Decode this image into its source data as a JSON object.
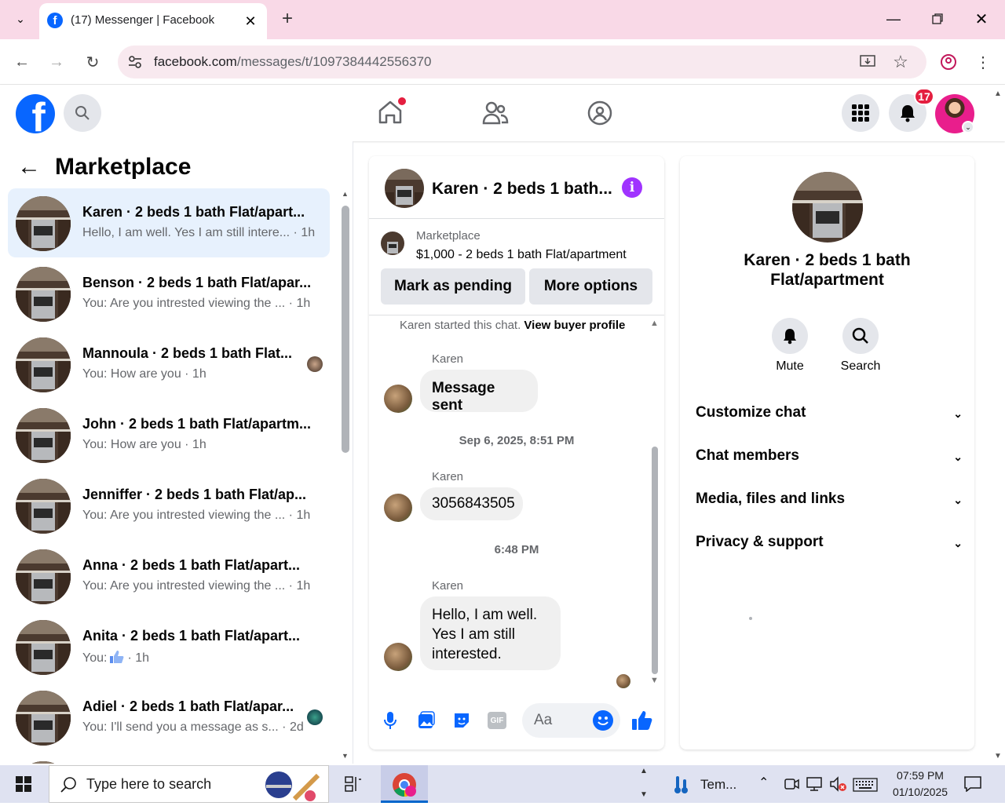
{
  "browser": {
    "tab_title": "(17) Messenger | Facebook",
    "url_domain": "facebook.com",
    "url_path": "/messages/t/1097384442556370"
  },
  "fb_header": {
    "notification_count": "17",
    "icons": [
      "facebook-logo",
      "search-icon",
      "home-icon",
      "friends-icon",
      "groups-icon",
      "menu-grid-icon",
      "bell-icon",
      "avatar"
    ]
  },
  "left": {
    "title": "Marketplace",
    "conversations": [
      {
        "name": "Karen · 2 beds 1 bath Flat/apart...",
        "preview": "Hello, I am well. Yes I am still intere... · 1h"
      },
      {
        "name": "Benson · 2 beds 1 bath Flat/apar...",
        "preview": "You: Are you intrested viewing the ... · 1h"
      },
      {
        "name": "Mannoula · 2 beds 1 bath Flat...",
        "preview": "You: How are you · 1h"
      },
      {
        "name": "John · 2 beds 1 bath Flat/apartm...",
        "preview": "You: How are you · 1h"
      },
      {
        "name": "Jenniffer · 2 beds 1 bath Flat/ap...",
        "preview": "You: Are you intrested viewing the ... · 1h"
      },
      {
        "name": "Anna · 2 beds 1 bath Flat/apart...",
        "preview": "You: Are you intrested viewing the ... · 1h"
      },
      {
        "name": "Anita · 2 beds 1 bath Flat/apart...",
        "preview_prefix": "You:",
        "preview": "· 1h"
      },
      {
        "name": "Adiel · 2 beds 1 bath Flat/apar...",
        "preview": "You: I'll send you a message as s... · 2d"
      }
    ]
  },
  "chat": {
    "title": "Karen · 2 beds 1 bath...",
    "listing_label": "Marketplace",
    "listing_detail": "$1,000 - 2 beds 1 bath Flat/apartment",
    "mark_pending": "Mark as pending",
    "more_options": "More options",
    "started_text": "Karen started this chat.",
    "view_profile": "View buyer profile",
    "sender_name": "Karen",
    "msg1": "Message sent",
    "ts1": "Sep 6, 2025, 8:51 PM",
    "msg2": "3056843505",
    "ts2": "6:48 PM",
    "msg3": "Hello, I am well. Yes I am still interested.",
    "input_placeholder": "Aa"
  },
  "info": {
    "name": "Karen · 2 beds 1 bath Flat/apartment",
    "mute": "Mute",
    "search": "Search",
    "sections": [
      "Customize chat",
      "Chat members",
      "Media, files and links",
      "Privacy & support"
    ]
  },
  "taskbar": {
    "search_placeholder": "Type here to search",
    "weather": "Tem...",
    "time": "07:59 PM",
    "date": "01/10/2025"
  },
  "colors": {
    "fb_blue": "#0866ff",
    "accent_purple": "#a033ff",
    "badge_red": "#e41e3f"
  }
}
